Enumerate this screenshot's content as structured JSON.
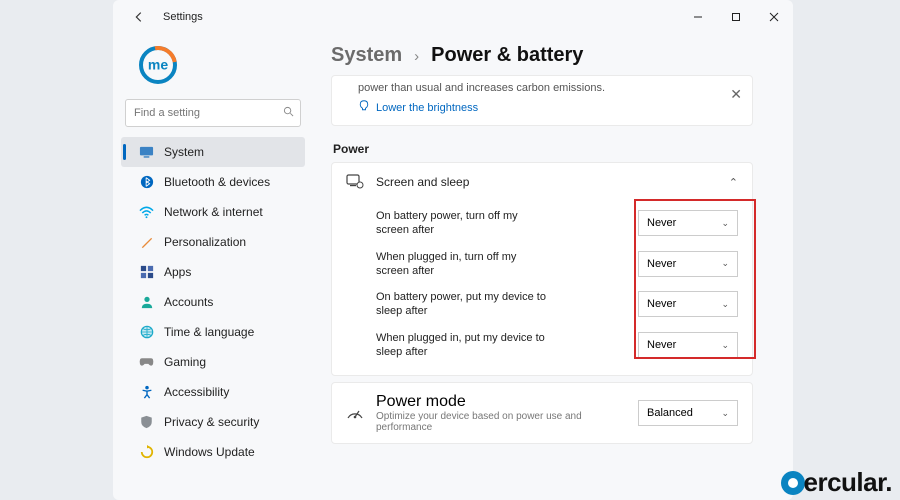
{
  "titlebar": {
    "title": "Settings"
  },
  "logo_text": "me",
  "search": {
    "placeholder": "Find a setting"
  },
  "sidebar": {
    "items": [
      {
        "label": "System",
        "icon": "monitor"
      },
      {
        "label": "Bluetooth & devices",
        "icon": "bluetooth"
      },
      {
        "label": "Network & internet",
        "icon": "wifi"
      },
      {
        "label": "Personalization",
        "icon": "brush"
      },
      {
        "label": "Apps",
        "icon": "apps"
      },
      {
        "label": "Accounts",
        "icon": "person"
      },
      {
        "label": "Time & language",
        "icon": "globe"
      },
      {
        "label": "Gaming",
        "icon": "gamepad"
      },
      {
        "label": "Accessibility",
        "icon": "accessibility"
      },
      {
        "label": "Privacy & security",
        "icon": "shield"
      },
      {
        "label": "Windows Update",
        "icon": "update"
      }
    ]
  },
  "breadcrumb": {
    "root": "System",
    "leaf": "Power & battery"
  },
  "tip": {
    "text": "power than usual and increases carbon emissions.",
    "link": "Lower the brightness"
  },
  "section_power": "Power",
  "screen_sleep": {
    "title": "Screen and sleep",
    "rows": [
      {
        "label": "On battery power, turn off my screen after",
        "value": "Never"
      },
      {
        "label": "When plugged in, turn off my screen after",
        "value": "Never"
      },
      {
        "label": "On battery power, put my device to sleep after",
        "value": "Never"
      },
      {
        "label": "When plugged in, put my device to sleep after",
        "value": "Never"
      }
    ]
  },
  "power_mode": {
    "title": "Power mode",
    "subtitle": "Optimize your device based on power use and performance",
    "value": "Balanced"
  },
  "watermark": "ercular."
}
